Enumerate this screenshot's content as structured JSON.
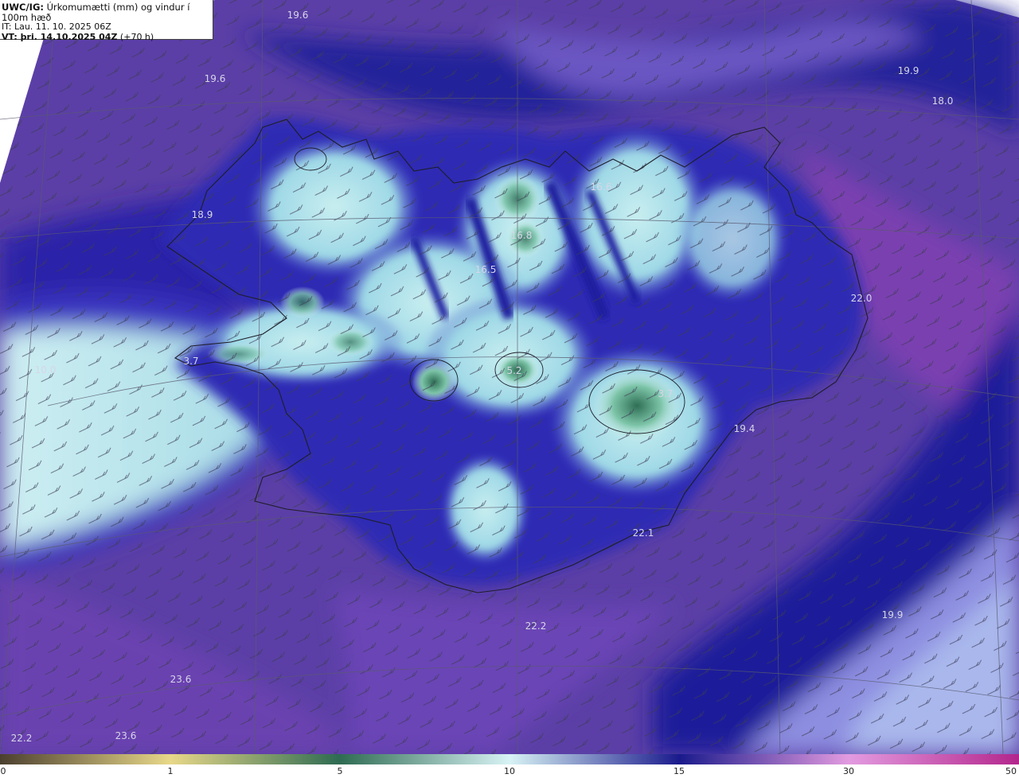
{
  "header": {
    "model_label": "UWC/IG:",
    "title": " Úrkomumætti (mm) og vindur í 100m hæð",
    "init_time": "IT: Lau. 11. 10. 2025 06Z",
    "valid_label": "VT: þri. 14.10.2025 04Z",
    "lead_time": " (+70 h)"
  },
  "temperature_labels": [
    {
      "text": "19.6"
    },
    {
      "text": "19.6"
    },
    {
      "text": "19.9"
    },
    {
      "text": "18.0"
    },
    {
      "text": "18.9"
    },
    {
      "text": "16.6"
    },
    {
      "text": "16.5"
    },
    {
      "text": "16.8"
    },
    {
      "text": "22.0"
    },
    {
      "text": "3.7"
    },
    {
      "text": "10.0"
    },
    {
      "text": "5.2"
    },
    {
      "text": "3.7"
    },
    {
      "text": "19.4"
    },
    {
      "text": "22.1"
    },
    {
      "text": "22.2"
    },
    {
      "text": "19.9"
    },
    {
      "text": "23.6"
    },
    {
      "text": "23.6"
    },
    {
      "text": "22.2"
    }
  ],
  "colorbar": {
    "ticks": [
      "0",
      "1",
      "5",
      "10",
      "15",
      "30",
      "50"
    ],
    "stops": [
      {
        "value": "0",
        "color": "#4b3f2f"
      },
      {
        "value": "1",
        "color": "#e8d889"
      },
      {
        "value": "5",
        "color": "#2e6b52"
      },
      {
        "value": "10",
        "color": "#d8f3f5"
      },
      {
        "value": "15",
        "color": "#1a1a8c"
      },
      {
        "value": "30",
        "color": "#e39be0"
      },
      {
        "value": "50",
        "color": "#b3268c"
      }
    ]
  },
  "colors": {
    "land_outline": "#1e1e28",
    "graticule": "#5a5a70",
    "wind_barb": "#3c3c55",
    "ocean_purple": "#5a3a9e",
    "deep_blue": "#1e1a9a",
    "light_band": "#c6ecf0"
  }
}
